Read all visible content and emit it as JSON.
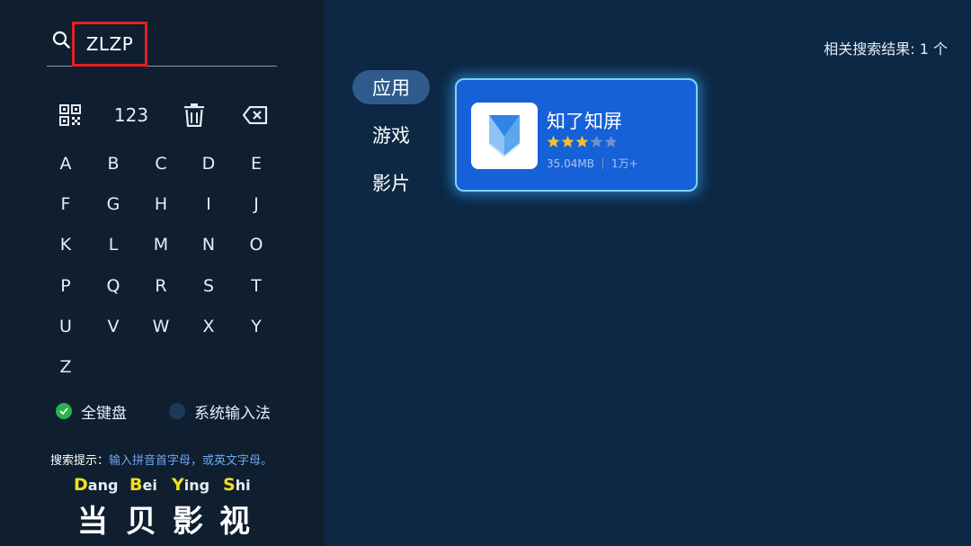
{
  "search": {
    "query": "ZLZP"
  },
  "toolbar": {
    "numeric_label": "123"
  },
  "keyboard": {
    "keys": [
      "A",
      "B",
      "C",
      "D",
      "E",
      "F",
      "G",
      "H",
      "I",
      "J",
      "K",
      "L",
      "M",
      "N",
      "O",
      "P",
      "Q",
      "R",
      "S",
      "T",
      "U",
      "V",
      "W",
      "X",
      "Y",
      "Z"
    ]
  },
  "input_modes": [
    {
      "label": "全键盘",
      "selected": true
    },
    {
      "label": "系统输入法",
      "selected": false
    }
  ],
  "search_hint": {
    "label": "搜索提示：",
    "text": "输入拼音首字母，或英文字母。"
  },
  "brand": {
    "pinyin": [
      {
        "initial": "D",
        "rest": "ang"
      },
      {
        "initial": "B",
        "rest": "ei"
      },
      {
        "initial": "Y",
        "rest": "ing"
      },
      {
        "initial": "S",
        "rest": "hi"
      }
    ],
    "chars": [
      "当",
      "贝",
      "影",
      "视"
    ]
  },
  "results": {
    "count_text": "相关搜索结果: 1 个"
  },
  "categories": [
    {
      "label": "应用",
      "active": true
    },
    {
      "label": "游戏",
      "active": false
    },
    {
      "label": "影片",
      "active": false
    }
  ],
  "app": {
    "name": "知了知屏",
    "rating": 3,
    "max_rating": 5,
    "size": "35.04MB",
    "downloads": "1万+"
  },
  "colors": {
    "accent": "#1660d8",
    "star_on": "#f4c12a",
    "star_off": "#6f93c9",
    "highlight_box": "#e32020",
    "mode_selected": "#2bb34a"
  }
}
